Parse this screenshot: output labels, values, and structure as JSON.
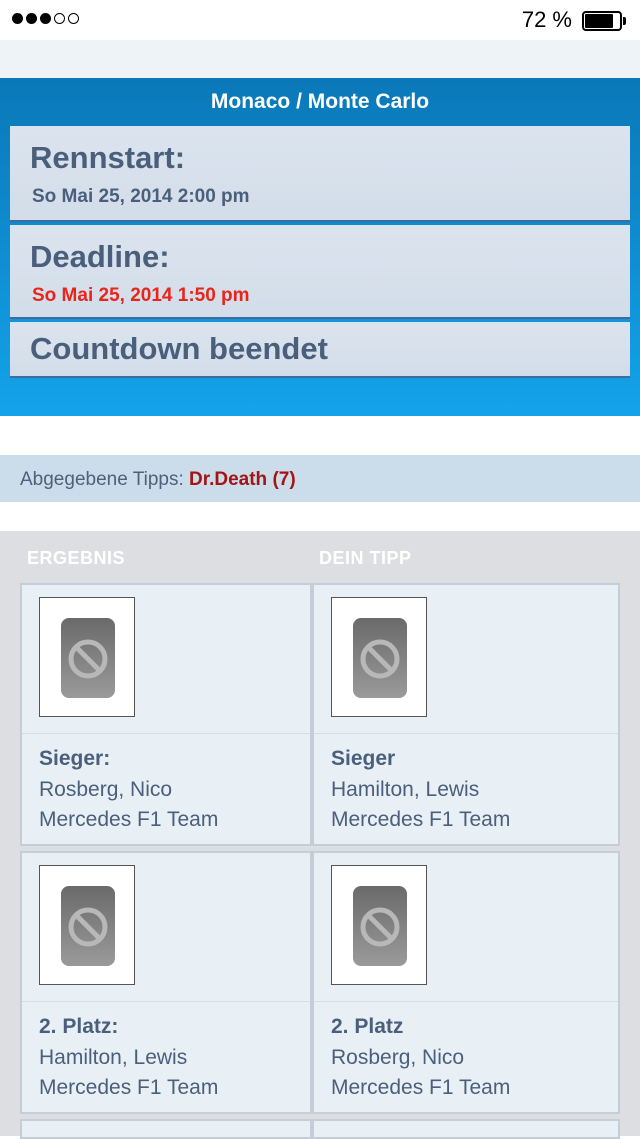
{
  "status_bar": {
    "battery_percent": "72 %",
    "signal_bars_filled": 3,
    "signal_bars_total": 5
  },
  "race": {
    "title": "Monaco / Monte Carlo",
    "start_label": "Rennstart:",
    "start_value": "So Mai 25, 2014 2:00 pm",
    "deadline_label": "Deadline:",
    "deadline_value": "So Mai 25, 2014 1:50 pm",
    "countdown": "Countdown beendet"
  },
  "tips": {
    "label": "Abgegebene Tipps:",
    "user": "Dr.Death (7)"
  },
  "results": {
    "col_result": "ERGEBNIS",
    "col_tip": "DEIN TIPP",
    "rows": [
      {
        "result": {
          "label": "Sieger:",
          "driver": "Rosberg, Nico",
          "team": "Mercedes F1 Team"
        },
        "tip": {
          "label": "Sieger",
          "driver": "Hamilton, Lewis",
          "team": "Mercedes F1 Team"
        }
      },
      {
        "result": {
          "label": "2. Platz:",
          "driver": "Hamilton, Lewis",
          "team": "Mercedes F1 Team"
        },
        "tip": {
          "label": "2. Platz",
          "driver": "Rosberg, Nico",
          "team": "Mercedes F1 Team"
        }
      }
    ]
  },
  "colors": {
    "header_blue": "#0f8fd3",
    "deadline_red": "#e8251b",
    "tips_user": "#a31414"
  },
  "icons": {
    "driver_photo": "no-image-placeholder-icon"
  }
}
